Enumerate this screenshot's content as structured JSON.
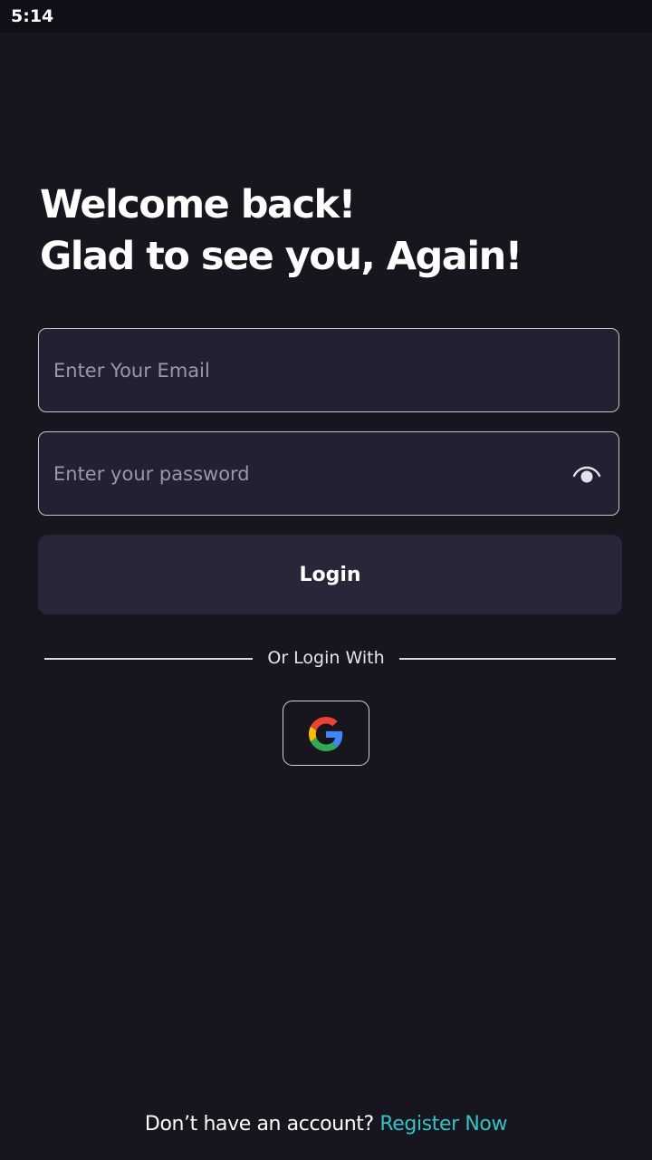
{
  "status_bar": {
    "time": "5:14"
  },
  "heading": {
    "line1": "Welcome back!",
    "line2": "Glad to see you, Again!"
  },
  "form": {
    "email_placeholder": "Enter Your Email",
    "password_placeholder": "Enter your password",
    "password_toggle_icon": "eye-icon",
    "login_label": "Login"
  },
  "social": {
    "divider_text": "Or Login With",
    "google_icon": "google-icon"
  },
  "footer": {
    "prompt": "Don’t have an account?",
    "register_label": "Register Now"
  },
  "colors": {
    "background": "#17161f",
    "field_background": "#222033",
    "button_background": "#28273a",
    "accent": "#35c2c1"
  }
}
